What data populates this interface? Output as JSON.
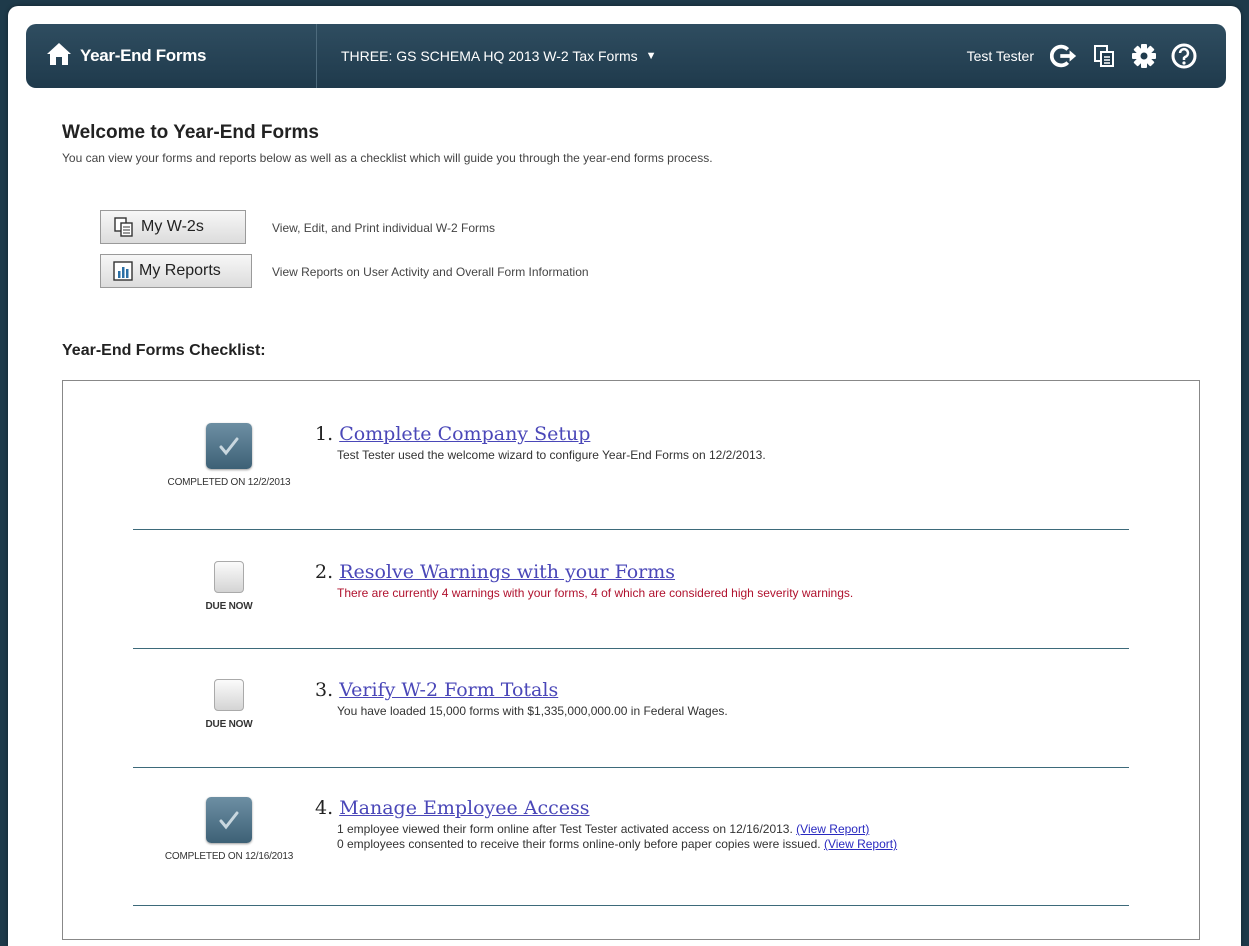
{
  "header": {
    "app_title": "Year-End Forms",
    "schema_label": "THREE: GS SCHEMA HQ 2013 W-2 Tax Forms",
    "user_name": "Test Tester",
    "icons": [
      "home-icon",
      "logout-icon",
      "documents-icon",
      "gear-icon",
      "help-icon"
    ]
  },
  "welcome": {
    "title": "Welcome to Year-End Forms",
    "subtitle": "You can view your forms and reports below as well as a checklist which will guide you through the year-end forms process."
  },
  "quick_links": [
    {
      "label": "My W-2s",
      "description": "View, Edit, and Print individual W-2 Forms",
      "icon": "documents-icon"
    },
    {
      "label": "My Reports",
      "description": "View Reports on User Activity and Overall Form Information",
      "icon": "chart-icon"
    }
  ],
  "checklist": {
    "title": "Year-End Forms Checklist:",
    "items": [
      {
        "number": "1.",
        "title": "Complete Company Setup",
        "status": "completed",
        "status_label": "COMPLETED ON 12/2/2013",
        "lines": [
          "Test Tester used the welcome wizard to configure Year-End Forms on 12/2/2013."
        ]
      },
      {
        "number": "2.",
        "title": "Resolve Warnings with your Forms",
        "status": "due",
        "status_label": "DUE NOW",
        "lines": [
          "There are currently 4 warnings with your forms, 4 of which are considered high severity warnings."
        ]
      },
      {
        "number": "3.",
        "title": "Verify W-2 Form Totals",
        "status": "due",
        "status_label": "DUE NOW",
        "lines": [
          "You have loaded 15,000 forms with $1,335,000,000.00 in Federal Wages."
        ]
      },
      {
        "number": "4.",
        "title": "Manage Employee Access",
        "status": "completed",
        "status_label": "COMPLETED ON 12/16/2013",
        "lines": [
          "1 employee viewed their form online after Test Tester activated access on 12/16/2013.",
          "0 employees consented to receive their forms online-only before paper copies were issued."
        ],
        "link_label": "(View Report)"
      }
    ]
  },
  "colors": {
    "header_bg": "#1f3a4c",
    "link": "#4a47b8",
    "warning_text": "#b0122e",
    "separator": "#3d6a7a"
  }
}
